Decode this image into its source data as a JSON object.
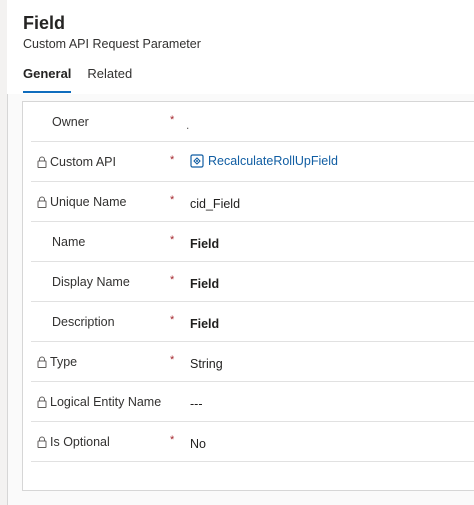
{
  "header": {
    "title": "Field",
    "subtitle": "Custom API Request Parameter"
  },
  "tabs": [
    {
      "label": "General",
      "active": true
    },
    {
      "label": "Related",
      "active": false
    }
  ],
  "fields": [
    {
      "label": "Owner",
      "locked": false,
      "required": true,
      "value": "."
    },
    {
      "label": "Custom API",
      "locked": true,
      "required": true,
      "value": "RecalculateRollUpField",
      "is_lookup": true
    },
    {
      "label": "Unique Name",
      "locked": true,
      "required": true,
      "value": "cid_Field"
    },
    {
      "label": "Name",
      "locked": false,
      "required": true,
      "value": "Field"
    },
    {
      "label": "Display Name",
      "locked": false,
      "required": true,
      "value": "Field"
    },
    {
      "label": "Description",
      "locked": false,
      "required": true,
      "value": "Field"
    },
    {
      "label": "Type",
      "locked": true,
      "required": true,
      "value": "String"
    },
    {
      "label": "Logical Entity Name",
      "locked": true,
      "required": false,
      "value": "---"
    },
    {
      "label": "Is Optional",
      "locked": true,
      "required": true,
      "value": "No"
    }
  ],
  "required_marker": "*",
  "colors": {
    "accent": "#0f6cbd",
    "link": "#115ea3",
    "required": "#a4262c"
  }
}
